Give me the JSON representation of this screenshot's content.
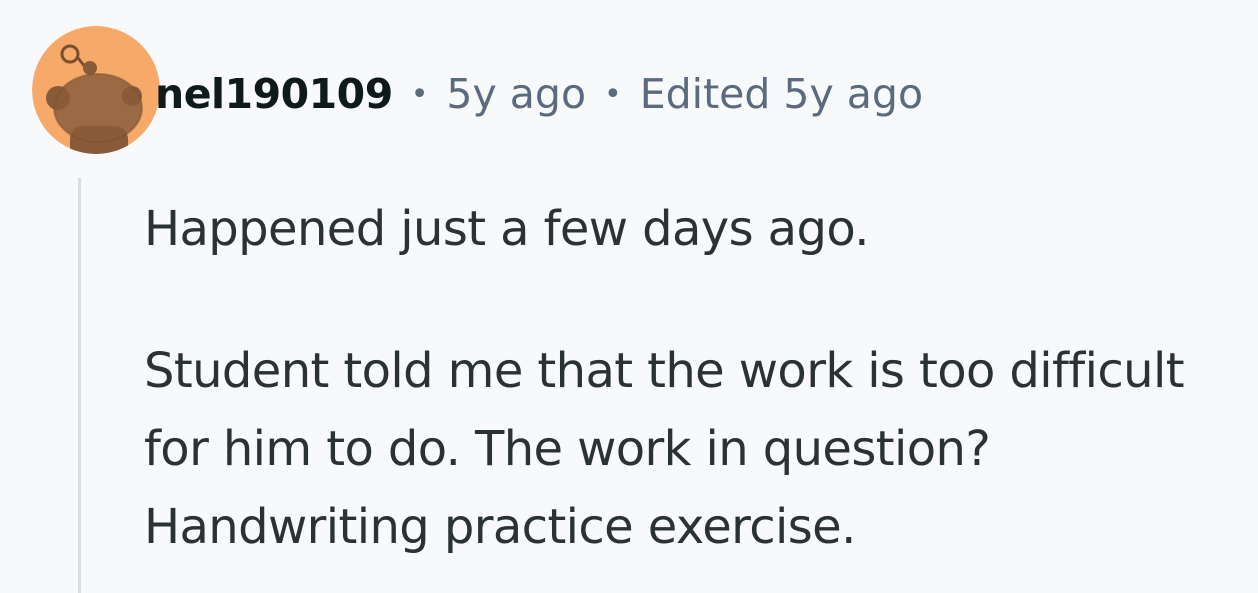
{
  "comment": {
    "avatar_icon": "reddit-snoo-avatar-icon",
    "avatar_bg": "#f7a96a",
    "username": "nel190109",
    "separator": "•",
    "timestamp": "5y ago",
    "edited": "Edited 5y ago",
    "paragraphs": [
      "Happened just a few days ago.",
      "Student told me that the work is too difficult for him to do. The work in question? Handwriting practice exercise."
    ]
  }
}
